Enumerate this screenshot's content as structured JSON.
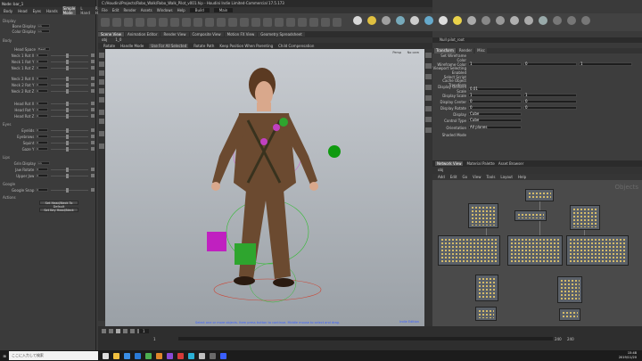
{
  "left_panel": {
    "title": "Node: bar_1",
    "toolbar": [
      "Body",
      "Head",
      "Eyes",
      "Hands",
      "Simple Mode",
      "L Hand",
      "R Hand",
      "L Leg",
      "R Leg"
    ],
    "active_tab": "Simple Mode",
    "sections": {
      "display": "Display",
      "body": "Body",
      "eyes": "Eyes",
      "lips": "Lips",
      "google": "Google",
      "actions": "Actions"
    },
    "rows": [
      {
        "label": "Bone Display",
        "value": "on"
      },
      {
        "label": "Color Display",
        "value": "on"
      },
      {
        "label": "Head Space",
        "value": "Head"
      },
      {
        "label": "Neck 1 Rot X",
        "value": "0"
      },
      {
        "label": "Neck 1 Rot Y",
        "value": "0"
      },
      {
        "label": "Neck 1 Rot Z",
        "value": "0"
      },
      {
        "label": "Neck 2 Rot X",
        "value": "0"
      },
      {
        "label": "Neck 2 Rot Y",
        "value": "0"
      },
      {
        "label": "Neck 2 Rot Z",
        "value": "0"
      },
      {
        "label": "Head Rot X",
        "value": "0"
      },
      {
        "label": "Head Rot Y",
        "value": "0"
      },
      {
        "label": "Head Rot Z",
        "value": "0"
      },
      {
        "label": "Eyelids",
        "value": "0"
      },
      {
        "label": "Eyebrows",
        "value": "0"
      },
      {
        "label": "Squint",
        "value": "0"
      },
      {
        "label": "Gaze Y",
        "value": "0"
      },
      {
        "label": "Grin Display",
        "value": "on"
      },
      {
        "label": "Jaw Rotate",
        "value": "0"
      },
      {
        "label": "Upper Jaw",
        "value": "0"
      },
      {
        "label": "Google Snap",
        "value": "0"
      }
    ],
    "buttons": [
      "Set Head/Neck To Default",
      "Set Key Head/Neck"
    ]
  },
  "window": {
    "title": "C:/Houdini/Projects/Robo_Walk/Robo_Walk_Pilot_v001.hip - Houdini Indie Limited-Commercial 17.5.173",
    "menu": [
      "File",
      "Edit",
      "Render",
      "Assets",
      "Windows",
      "Help"
    ],
    "desktop": "Build",
    "main_menu": "Main"
  },
  "viewport": {
    "tabs": [
      "Scene View",
      "Animation Editor",
      "Render View",
      "Composite View",
      "Motion FX View",
      "Geometry Spreadsheet"
    ],
    "active_tab": "Scene View",
    "path": "obj",
    "context": "1_0",
    "ops": [
      "Rotate",
      "Handle Mode",
      "Use For All Selected",
      "Rotate Path",
      "Keep Position When Parenting",
      "Child Compensation"
    ],
    "camera_label": "Persp",
    "cam_button": "No cam",
    "hint": "Select one or more objects. Item press button to continue. Middle mouse to select and drag.",
    "indie_label": "Indie Edition"
  },
  "timeline": {
    "frame": "1",
    "start": "1",
    "end": "240",
    "end2": "240"
  },
  "params": {
    "header": "Null  pilot_root",
    "tabs": [
      "Transform",
      "Render",
      "Misc"
    ],
    "active_tab": "Transform",
    "rows": [
      {
        "label": "Set Wireframe Color",
        "values": []
      },
      {
        "label": "Wireframe Color",
        "values": [
          "1",
          "0",
          "1"
        ]
      },
      {
        "label": "Viewport Selecting Enabled",
        "values": []
      },
      {
        "label": "Select Script",
        "values": []
      },
      {
        "label": "Cache Object Transform",
        "values": []
      },
      {
        "label": "Display Uniform Scale",
        "values": [
          "0.01"
        ]
      },
      {
        "label": "Display Scale",
        "values": [
          "1",
          "1"
        ]
      },
      {
        "label": "Display Center",
        "values": [
          "0",
          "0"
        ]
      },
      {
        "label": "Display Rotate",
        "values": [
          "0",
          "0"
        ]
      },
      {
        "label": "Display",
        "values": [
          "Cube"
        ]
      },
      {
        "label": "Control Type",
        "values": [
          "Cube"
        ]
      },
      {
        "label": "Orientation",
        "values": [
          "All planes"
        ]
      },
      {
        "label": "Shaded Mode",
        "values": []
      }
    ]
  },
  "network": {
    "tabs": [
      "Network View",
      "Material Palette",
      "Asset Browser"
    ],
    "active_tab": "Network View",
    "path": "obj",
    "menu": [
      "Add",
      "Edit",
      "Go",
      "View",
      "Tools",
      "Layout",
      "Help"
    ],
    "label": "Objects"
  },
  "taskbar": {
    "search": "ここに入力して検索",
    "time": "15:48",
    "date": "2019/11/20"
  },
  "colors": {
    "accent": "#3a5fff",
    "magenta": "#c040c0",
    "green": "#2ea52e"
  }
}
